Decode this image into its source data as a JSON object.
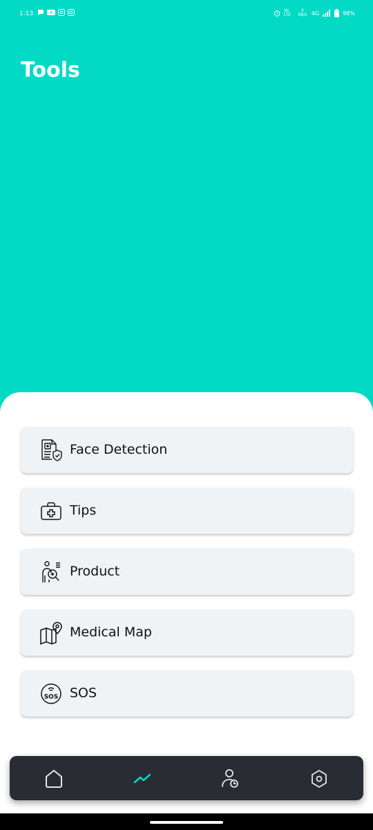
{
  "status_bar": {
    "time": "1:13",
    "network": "4G",
    "battery": "98%",
    "volte": "Vo LTE",
    "speed": "0 KB/s"
  },
  "page": {
    "title": "Tools"
  },
  "tools": [
    {
      "label": "Face Detection",
      "icon": "medical-record-shield-icon"
    },
    {
      "label": "Tips",
      "icon": "first-aid-kit-icon"
    },
    {
      "label": "Product",
      "icon": "person-search-icon"
    },
    {
      "label": "Medical Map",
      "icon": "map-pin-icon"
    },
    {
      "label": "SOS",
      "icon": "sos-icon"
    }
  ],
  "bottom_nav": {
    "items": [
      {
        "name": "home",
        "icon": "home-icon",
        "active": false
      },
      {
        "name": "tools",
        "icon": "trend-line-icon",
        "active": true
      },
      {
        "name": "profile",
        "icon": "user-clock-icon",
        "active": false
      },
      {
        "name": "settings",
        "icon": "hexagon-settings-icon",
        "active": false
      }
    ],
    "active_color": "#03dac6",
    "inactive_color": "#e8e8e8"
  },
  "colors": {
    "header_bg": "#03dac6",
    "card_bg": "#eff3f6",
    "nav_bg": "#292c33"
  }
}
